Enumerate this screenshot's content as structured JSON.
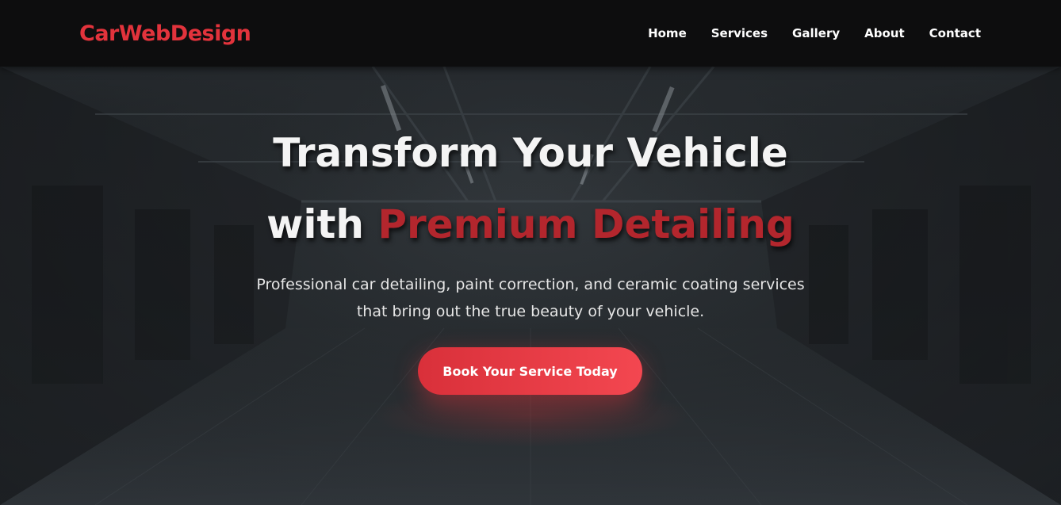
{
  "brand": {
    "name": "CarWebDesign",
    "color": "#e2333c"
  },
  "nav": {
    "items": [
      {
        "label": "Home"
      },
      {
        "label": "Services"
      },
      {
        "label": "Gallery"
      },
      {
        "label": "About"
      },
      {
        "label": "Contact"
      }
    ]
  },
  "hero": {
    "title_line1": "Transform Your Vehicle",
    "title_prefix": "with ",
    "title_accent": "Premium Detailing",
    "subtitle": "Professional car detailing, paint correction, and ceramic coating services that bring out the true beauty of your vehicle.",
    "cta_label": "Book Your Service Today",
    "accent_color": "#b3262d",
    "cta_color": "#e8363f"
  }
}
